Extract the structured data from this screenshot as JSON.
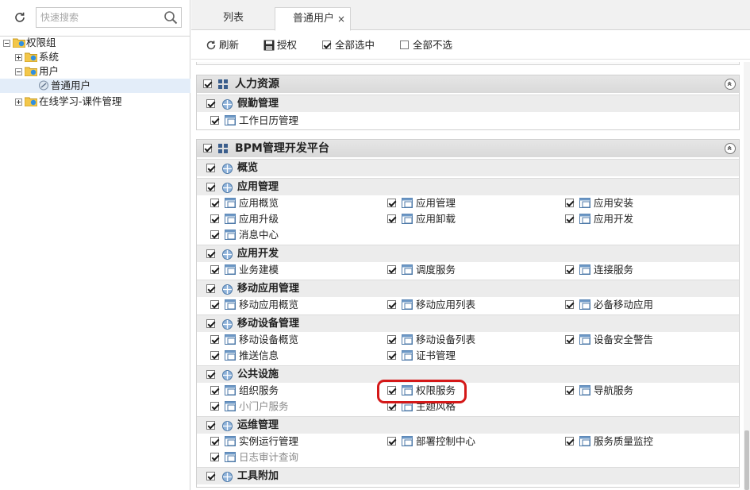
{
  "sidebar": {
    "search_placeholder": "快速搜索",
    "tree": [
      {
        "label": "权限组",
        "expanded": true
      },
      {
        "label": "系统",
        "expanded": false
      },
      {
        "label": "用户",
        "expanded": true
      },
      {
        "label": "普通用户",
        "selected": true
      },
      {
        "label": "在线学习-课件管理",
        "expanded": false
      }
    ]
  },
  "tabs": [
    {
      "label": "列表",
      "active": false
    },
    {
      "label": "普通用户",
      "active": true,
      "close": "×"
    }
  ],
  "toolbar": {
    "refresh": "刷新",
    "authorize": "授权",
    "select_all": "全部选中",
    "deselect_all": "全部不选"
  },
  "groups": [
    {
      "title": "人力资源",
      "sections": [
        {
          "title": "假勤管理",
          "items": [
            "工作日历管理"
          ]
        }
      ]
    },
    {
      "title": "BPM管理开发平台",
      "sections": [
        {
          "title": "概览",
          "items": []
        },
        {
          "title": "应用管理",
          "items": [
            "应用概览",
            "应用管理",
            "应用安装",
            "应用升级",
            "应用卸载",
            "应用开发",
            "消息中心"
          ]
        },
        {
          "title": "应用开发",
          "items": [
            "业务建模",
            "调度服务",
            "连接服务"
          ]
        },
        {
          "title": "移动应用管理",
          "items": [
            "移动应用概览",
            "移动应用列表",
            "必备移动应用"
          ]
        },
        {
          "title": "移动设备管理",
          "items": [
            "移动设备概览",
            "移动设备列表",
            "设备安全警告",
            "推送信息",
            "证书管理"
          ]
        },
        {
          "title": "公共设施",
          "items": [
            "组织服务",
            "权限服务",
            "导航服务",
            "小门户服务",
            "主题风格"
          ]
        },
        {
          "title": "运维管理",
          "items": [
            "实例运行管理",
            "部署控制中心",
            "服务质量监控",
            "日志审计查询"
          ]
        },
        {
          "title": "工具附加",
          "items": []
        }
      ]
    }
  ],
  "colors": {
    "highlight_ring": "#d41818",
    "group_header": "#dcdcdc",
    "section_header": "#ececec",
    "selected_tree": "#e3edf9"
  }
}
